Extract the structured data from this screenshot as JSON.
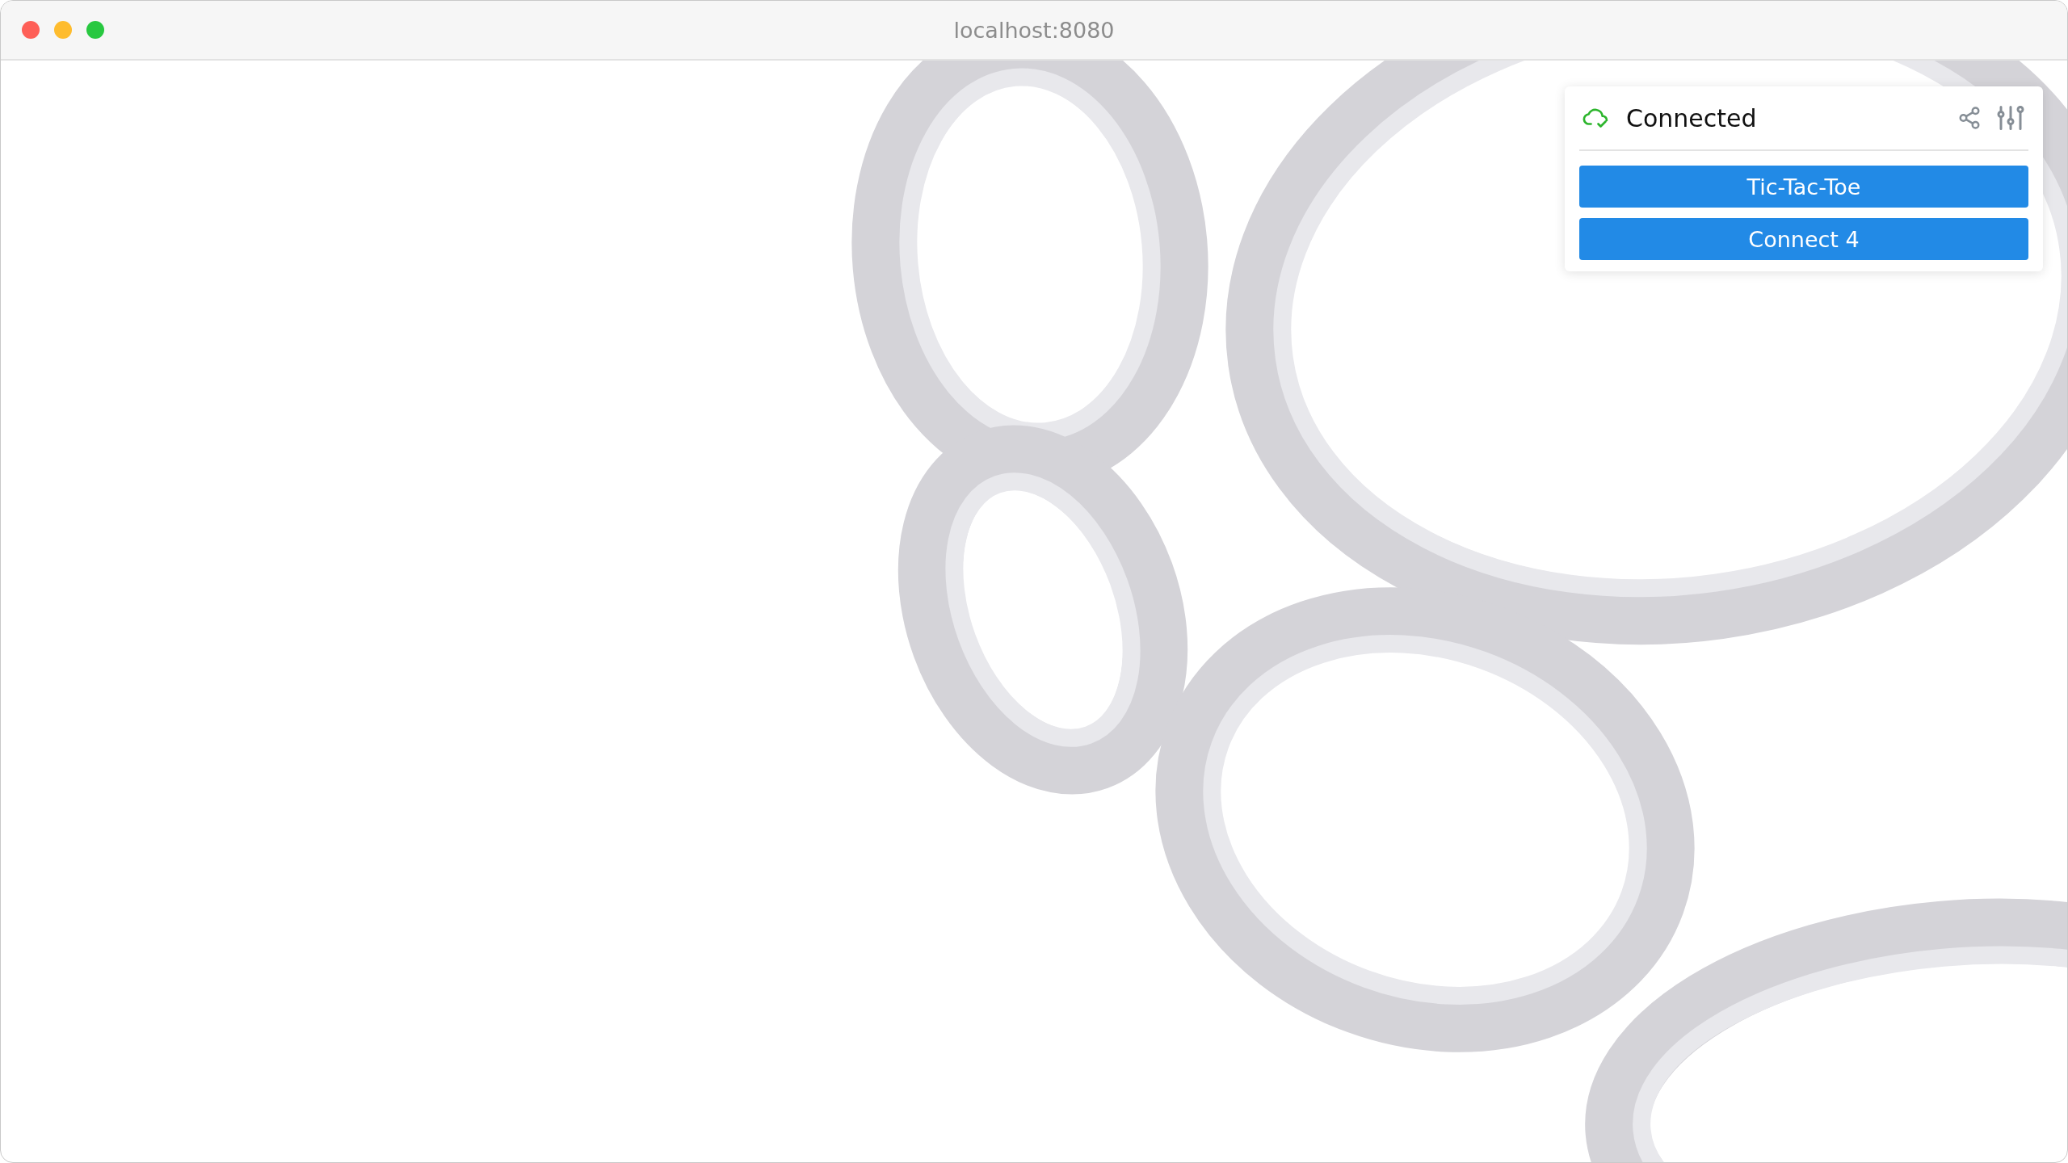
{
  "window": {
    "title": "localhost:8080"
  },
  "status": {
    "label": "Connected",
    "connected": true
  },
  "games": [
    {
      "label": "Tic-Tac-Toe"
    },
    {
      "label": "Connect 4"
    }
  ]
}
